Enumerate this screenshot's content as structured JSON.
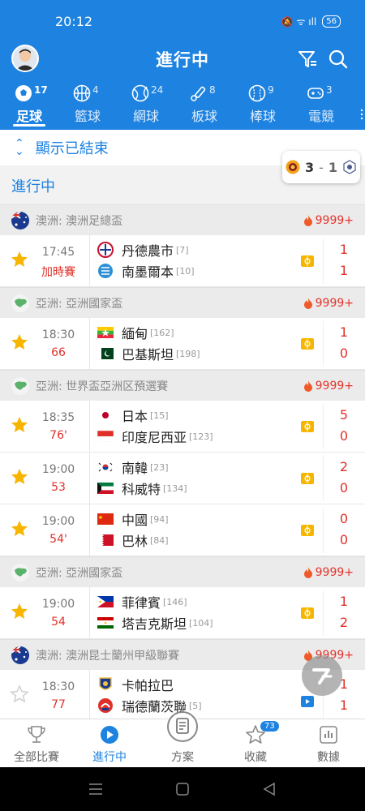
{
  "status_bar": {
    "time": "20:12",
    "icons": "🔕 ᯤ ıll",
    "battery": "56"
  },
  "header": {
    "title": "進行中"
  },
  "sport_tabs": [
    {
      "label": "足球",
      "count": "17",
      "icon": "soccer-icon",
      "active": true
    },
    {
      "label": "籃球",
      "count": "4",
      "icon": "basketball-icon"
    },
    {
      "label": "網球",
      "count": "24",
      "icon": "tennis-icon"
    },
    {
      "label": "板球",
      "count": "8",
      "icon": "cricket-icon"
    },
    {
      "label": "棒球",
      "count": "9",
      "icon": "baseball-icon"
    },
    {
      "label": "電競",
      "count": "3",
      "icon": "gamepad-icon"
    }
  ],
  "show_finished": {
    "label": "顯示已結束"
  },
  "floating_score": {
    "home": "3",
    "separator": "-",
    "away": "1"
  },
  "section": {
    "title": "進行中"
  },
  "leagues": [
    {
      "name": "澳洲: 澳洲足總盃",
      "hot": "9999+",
      "flag": "australia",
      "matches": [
        {
          "time": "17:45",
          "status": "加時賽",
          "home": "丹德農市",
          "home_rank": "[7]",
          "away": "南墨爾本",
          "away_rank": "[10]",
          "home_score": "1",
          "away_score": "1",
          "starred": true
        }
      ]
    },
    {
      "name": "亞洲: 亞洲國家盃",
      "hot": "9999+",
      "flag": "asia",
      "matches": [
        {
          "time": "18:30",
          "status": "66",
          "home": "緬甸",
          "home_rank": "[162]",
          "away": "巴基斯坦",
          "away_rank": "[198]",
          "home_score": "1",
          "away_score": "0",
          "starred": true
        }
      ]
    },
    {
      "name": "亞洲: 世界盃亞洲区預選賽",
      "hot": "9999+",
      "flag": "asia",
      "matches": [
        {
          "time": "18:35",
          "status": "76'",
          "home": "日本",
          "home_rank": "[15]",
          "away": "印度尼西亚",
          "away_rank": "[123]",
          "home_score": "5",
          "away_score": "0",
          "starred": true
        },
        {
          "time": "19:00",
          "status": "53",
          "home": "南韓",
          "home_rank": "[23]",
          "away": "科威特",
          "away_rank": "[134]",
          "home_score": "2",
          "away_score": "0",
          "starred": true
        },
        {
          "time": "19:00",
          "status": "54'",
          "home": "中國",
          "home_rank": "[94]",
          "away": "巴林",
          "away_rank": "[84]",
          "home_score": "0",
          "away_score": "0",
          "starred": true
        }
      ]
    },
    {
      "name": "亞洲: 亞洲國家盃",
      "hot": "9999+",
      "flag": "asia",
      "matches": [
        {
          "time": "19:00",
          "status": "54",
          "home": "菲律賓",
          "home_rank": "[146]",
          "away": "塔吉克斯坦",
          "away_rank": "[104]",
          "home_score": "1",
          "away_score": "2",
          "starred": true
        }
      ]
    },
    {
      "name": "澳洲: 澳洲昆士蘭州甲級聯賽",
      "hot": "9999+",
      "flag": "australia",
      "matches": [
        {
          "time": "18:30",
          "status": "77",
          "home": "卡帕拉巴",
          "home_rank": "",
          "away": "瑞德蘭茨聯",
          "away_rank": "[5]",
          "home_score": "1",
          "away_score": "1",
          "starred": false
        }
      ]
    }
  ],
  "bottom_nav": [
    {
      "label": "全部比賽",
      "icon": "trophy-icon"
    },
    {
      "label": "進行中",
      "icon": "play-icon",
      "active": true
    },
    {
      "label": "方案",
      "icon": "document-icon"
    },
    {
      "label": "收藏",
      "icon": "star-outline-icon",
      "badge": "73"
    },
    {
      "label": "數據",
      "icon": "chart-icon"
    }
  ],
  "colors": {
    "primary": "#1d82e0",
    "score_red": "#e0302a",
    "star": "#f7b500"
  }
}
